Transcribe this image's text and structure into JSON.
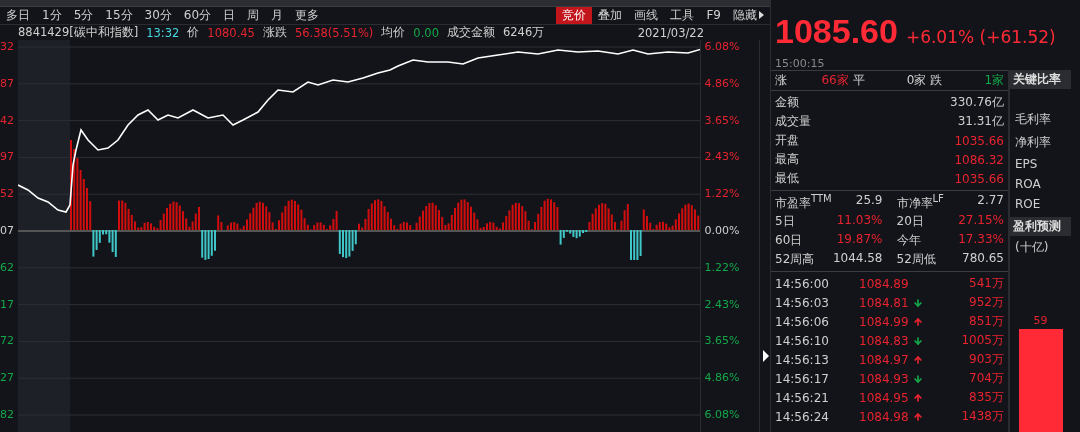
{
  "period_tabs": [
    {
      "label": "多日",
      "selected": false
    },
    {
      "label": "1分",
      "selected": false
    },
    {
      "label": "5分",
      "selected": false
    },
    {
      "label": "15分",
      "selected": false
    },
    {
      "label": "30分",
      "selected": false
    },
    {
      "label": "60分",
      "selected": false
    },
    {
      "label": "日",
      "selected": false
    },
    {
      "label": "周",
      "selected": false
    },
    {
      "label": "月",
      "selected": false
    },
    {
      "label": "更多",
      "selected": false
    }
  ],
  "tools": [
    {
      "label": "竞价",
      "selected": true
    },
    {
      "label": "叠加",
      "selected": false
    },
    {
      "label": "画线",
      "selected": false
    },
    {
      "label": "工具",
      "selected": false
    },
    {
      "label": "F9",
      "selected": false
    },
    {
      "label": "隐藏",
      "selected": false
    }
  ],
  "quote_line": {
    "code": "8841429[碳中和指数]",
    "time": "13:32",
    "price_label": "价",
    "price": "1080.45",
    "change_label": "涨跌",
    "change": "56.38(5.51%)",
    "avg_label": "均价",
    "avg": "0.00",
    "amount_label": "成交金额",
    "amount": "6246万",
    "date": "2021/03/22"
  },
  "left_axis": [
    {
      "label": "32",
      "kind": "up"
    },
    {
      "label": "87",
      "kind": "up"
    },
    {
      "label": "42",
      "kind": "up"
    },
    {
      "label": "97",
      "kind": "up"
    },
    {
      "label": "52",
      "kind": "up"
    },
    {
      "label": "07",
      "kind": "flat"
    },
    {
      "label": "62",
      "kind": "down"
    },
    {
      "label": "17",
      "kind": "down"
    },
    {
      "label": "72",
      "kind": "down"
    },
    {
      "label": "27",
      "kind": "down"
    },
    {
      "label": "82",
      "kind": "down"
    }
  ],
  "right_axis": [
    {
      "label": "6.08%",
      "kind": "up"
    },
    {
      "label": "4.86%",
      "kind": "up"
    },
    {
      "label": "3.65%",
      "kind": "up"
    },
    {
      "label": "2.43%",
      "kind": "up"
    },
    {
      "label": "1.22%",
      "kind": "up"
    },
    {
      "label": "0.00%",
      "kind": "flat"
    },
    {
      "label": "1.22%",
      "kind": "down"
    },
    {
      "label": "2.43%",
      "kind": "down"
    },
    {
      "label": "3.65%",
      "kind": "down"
    },
    {
      "label": "4.86%",
      "kind": "down"
    },
    {
      "label": "6.08%",
      "kind": "down"
    }
  ],
  "summary": {
    "price": "1085.60",
    "change": "+6.01% (+61.52)",
    "time": "15:00:15"
  },
  "breadth": [
    {
      "label": "涨",
      "count": "66家",
      "kind": "up"
    },
    {
      "label": "平",
      "count": "0家",
      "kind": "flat"
    },
    {
      "label": "跌",
      "count": "1家",
      "kind": "down"
    }
  ],
  "stats": [
    {
      "label": "金额",
      "value": "330.76亿",
      "kind": "flat"
    },
    {
      "label": "成交量",
      "value": "31.31亿",
      "kind": "flat"
    },
    {
      "label": "开盘",
      "value": "1035.66",
      "kind": "up"
    },
    {
      "label": "最高",
      "value": "1086.32",
      "kind": "up"
    },
    {
      "label": "最低",
      "value": "1035.66",
      "kind": "up"
    }
  ],
  "ratios": [
    [
      {
        "label": "市盈率$^{TTM}$",
        "value": "25.9",
        "kind": "flat"
      },
      {
        "label": "市净率$^{LF}$",
        "value": "2.77",
        "kind": "flat"
      }
    ],
    [
      {
        "label": "5日",
        "value": "11.03%",
        "kind": "up"
      },
      {
        "label": "20日",
        "value": "27.15%",
        "kind": "up"
      }
    ],
    [
      {
        "label": "60日",
        "value": "19.87%",
        "kind": "up"
      },
      {
        "label": "今年",
        "value": "17.33%",
        "kind": "up"
      }
    ],
    [
      {
        "label": "52周高",
        "value": "1044.58",
        "kind": "flat"
      },
      {
        "label": "52周低",
        "value": "780.65",
        "kind": "flat"
      }
    ]
  ],
  "ticks": [
    {
      "time": "14:56:00",
      "price": "1084.89",
      "kind": "none",
      "volume": "541万"
    },
    {
      "time": "14:56:03",
      "price": "1084.81",
      "kind": "down",
      "volume": "952万"
    },
    {
      "time": "14:56:06",
      "price": "1084.99",
      "kind": "up",
      "volume": "851万"
    },
    {
      "time": "14:56:10",
      "price": "1084.83",
      "kind": "down",
      "volume": "1005万"
    },
    {
      "time": "14:56:13",
      "price": "1084.97",
      "kind": "up",
      "volume": "903万"
    },
    {
      "time": "14:56:17",
      "price": "1084.93",
      "kind": "down",
      "volume": "704万"
    },
    {
      "time": "14:56:21",
      "price": "1084.95",
      "kind": "up",
      "volume": "835万"
    },
    {
      "time": "14:56:24",
      "price": "1084.98",
      "kind": "up",
      "volume": "1438万"
    }
  ],
  "key_ratios": {
    "title": "关键比率",
    "items": [
      "毛利率",
      "净利率",
      "EPS",
      "ROA",
      "ROE"
    ]
  },
  "forecast": {
    "title": "盈利预测",
    "unit": "(十亿)",
    "bar_label": "59"
  }
}
